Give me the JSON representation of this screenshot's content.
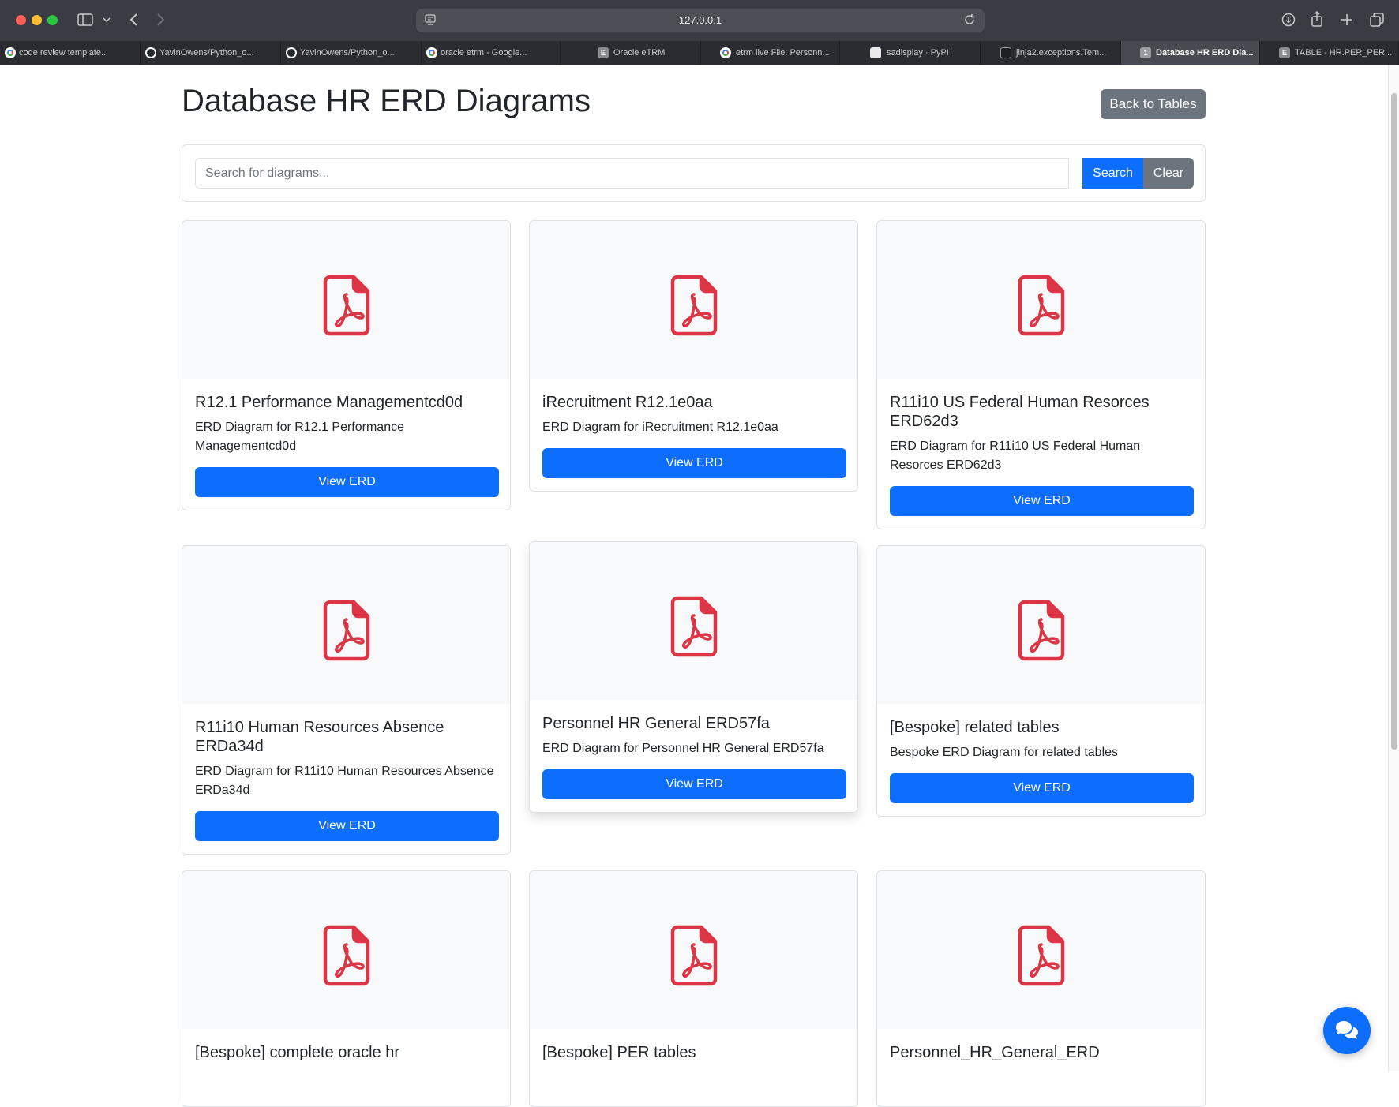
{
  "browser": {
    "url": "127.0.0.1",
    "tabs": [
      {
        "label": "code review template...",
        "favicon": "google-icon"
      },
      {
        "label": "YavinOwens/Python_o...",
        "favicon": "github-icon"
      },
      {
        "label": "YavinOwens/Python_o...",
        "favicon": "github-icon"
      },
      {
        "label": "oracle etrm - Google...",
        "favicon": "google-icon"
      },
      {
        "label": "Oracle eTRM",
        "favicon": "etrm-icon",
        "favicon_letter": "E"
      },
      {
        "label": "etrm live File: Personn...",
        "favicon": "google-icon"
      },
      {
        "label": "sadisplay · PyPI",
        "favicon": "pypi-icon"
      },
      {
        "label": "jinja2.exceptions.Tem...",
        "favicon": "terminal-icon"
      },
      {
        "label": "Database HR ERD Dia...",
        "favicon": "page-icon",
        "favicon_letter": "1",
        "active": true
      },
      {
        "label": "TABLE - HR.PER_PER...",
        "favicon": "etrm-icon",
        "favicon_letter": "E"
      }
    ]
  },
  "header": {
    "title": "Database HR ERD Diagrams",
    "back_label": "Back to Tables"
  },
  "search": {
    "placeholder": "Search for diagrams...",
    "search_label": "Search",
    "clear_label": "Clear"
  },
  "cards": [
    {
      "title": "R12.1 Performance Managementcd0d",
      "description": "ERD Diagram for R12.1 Performance Managementcd0d",
      "button": "View ERD"
    },
    {
      "title": "iRecruitment R12.1e0aa",
      "description": "ERD Diagram for iRecruitment R12.1e0aa",
      "button": "View ERD"
    },
    {
      "title": "R11i10 US Federal Human Resorces ERD62d3",
      "description": "ERD Diagram for R11i10 US Federal Human Resorces ERD62d3",
      "button": "View ERD"
    },
    {
      "title": "R11i10 Human Resources Absence ERDa34d",
      "description": "ERD Diagram for R11i10 Human Resources Absence ERDa34d",
      "button": "View ERD"
    },
    {
      "title": "Personnel HR General ERD57fa",
      "description": "ERD Diagram for Personnel HR General ERD57fa",
      "button": "View ERD"
    },
    {
      "title": "[Bespoke] related tables",
      "description": "Bespoke ERD Diagram for related tables",
      "button": "View ERD"
    },
    {
      "title": "[Bespoke] complete oracle hr"
    },
    {
      "title": "[Bespoke] PER tables"
    },
    {
      "title": "Personnel_HR_General_ERD"
    }
  ],
  "colors": {
    "primary": "#0d6efd",
    "secondary": "#6c757d",
    "pdf_red": "#dc3545"
  }
}
